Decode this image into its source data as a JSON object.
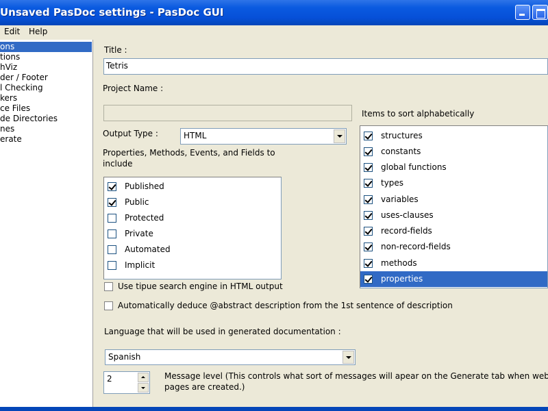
{
  "window": {
    "title": "Unsaved PasDoc settings - PasDoc GUI"
  },
  "menu": {
    "items": [
      "Edit",
      "Help"
    ]
  },
  "sidebar": {
    "items": [
      {
        "label": "ons",
        "selected": true
      },
      {
        "label": "tions",
        "selected": false
      },
      {
        "label": "hViz",
        "selected": false
      },
      {
        "label": "der / Footer",
        "selected": false
      },
      {
        "label": "l Checking",
        "selected": false
      },
      {
        "label": "kers",
        "selected": false
      },
      {
        "label": "ce Files",
        "selected": false
      },
      {
        "label": "de Directories",
        "selected": false
      },
      {
        "label": "nes",
        "selected": false
      },
      {
        "label": "erate",
        "selected": false
      }
    ]
  },
  "form": {
    "title_label": "Title :",
    "title_value": "Tetris",
    "project_name_label": "Project Name :",
    "project_name_value": "",
    "output_type_label": "Output Type :",
    "output_type_value": "HTML",
    "include_label": "Properties, Methods, Events, and Fields to include",
    "visibility": [
      {
        "label": "Published",
        "checked": true
      },
      {
        "label": "Public",
        "checked": true
      },
      {
        "label": "Protected",
        "checked": false
      },
      {
        "label": "Private",
        "checked": false
      },
      {
        "label": "Automated",
        "checked": false
      },
      {
        "label": "Implicit",
        "checked": false
      }
    ],
    "sort_label": "Items to sort alphabetically",
    "sort_items": [
      {
        "label": "structures",
        "checked": true,
        "selected": false
      },
      {
        "label": "constants",
        "checked": true,
        "selected": false
      },
      {
        "label": "global functions",
        "checked": true,
        "selected": false
      },
      {
        "label": "types",
        "checked": true,
        "selected": false
      },
      {
        "label": "variables",
        "checked": true,
        "selected": false
      },
      {
        "label": "uses-clauses",
        "checked": true,
        "selected": false
      },
      {
        "label": "record-fields",
        "checked": true,
        "selected": false
      },
      {
        "label": "non-record-fields",
        "checked": true,
        "selected": false
      },
      {
        "label": "methods",
        "checked": true,
        "selected": false
      },
      {
        "label": "properties",
        "checked": true,
        "selected": true
      }
    ],
    "tipue_label": "Use tipue search engine in HTML output",
    "tipue_checked": false,
    "abstract_label": "Automatically deduce @abstract description from the 1st sentence of description",
    "abstract_checked": false,
    "language_label": "Language that will be used in generated documentation :",
    "language_value": "Spanish",
    "message_level_value": "2",
    "message_level_label_1": "Message level (This controls what sort of messages will apear on the Generate tab when web",
    "message_level_label_2": "pages are created.)"
  },
  "colors": {
    "titlebar": "#0a5ae0",
    "selection": "#316ac5",
    "window_bg": "#ece9d8"
  }
}
